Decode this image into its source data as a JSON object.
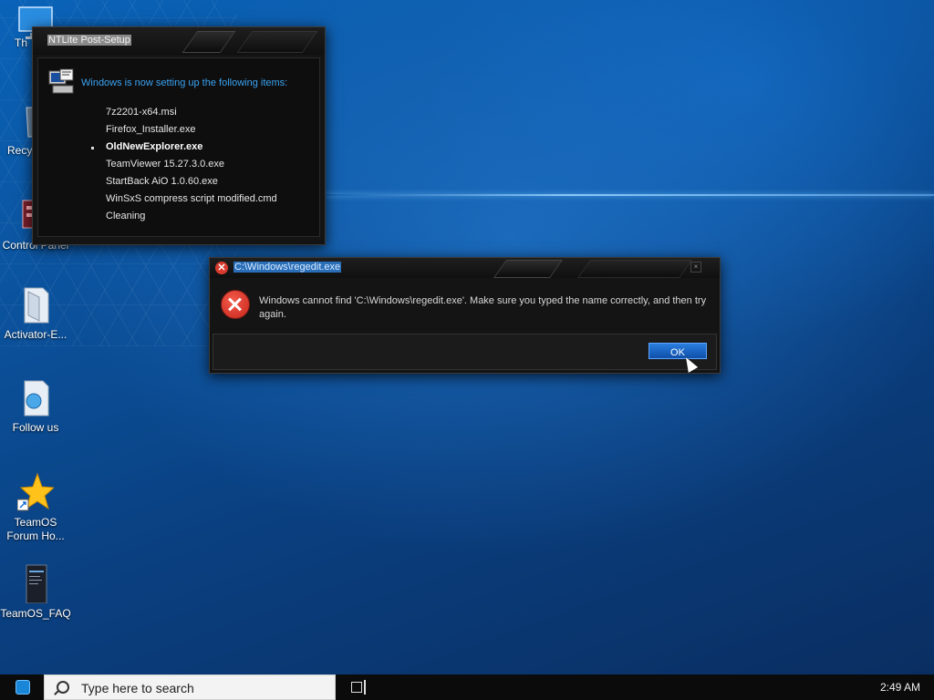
{
  "desktop": {
    "icons": [
      {
        "label": "Th"
      },
      {
        "label": "Recy"
      },
      {
        "label": "Control Panel"
      },
      {
        "label": "Activator-E..."
      },
      {
        "label": "Follow us"
      },
      {
        "label": "TeamOS\nForum Ho..."
      },
      {
        "label": "TeamOS_FAQ"
      }
    ]
  },
  "ntlite": {
    "title": "NTLite Post-Setup",
    "heading": "Windows is now setting up the following items:",
    "items": [
      "7z2201-x64.msi",
      "Firefox_Installer.exe",
      "OldNewExplorer.exe",
      "TeamViewer 15.27.3.0.exe",
      "StartBack AiO 1.0.60.exe",
      "WinSxS compress script modified.cmd",
      "Cleaning"
    ],
    "active_item": "OldNewExplorer.exe"
  },
  "error_dialog": {
    "title": "C:\\Windows\\regedit.exe",
    "message": "Windows cannot find 'C:\\Windows\\regedit.exe'. Make sure you typed the name correctly, and then try again.",
    "ok_label": "OK"
  },
  "taskbar": {
    "search_placeholder": "Type here to search",
    "clock": "2:49 AM"
  },
  "colors": {
    "accent": "#3aa3f0",
    "error": "#d83b2e",
    "ok_button": "#1c66c6"
  }
}
